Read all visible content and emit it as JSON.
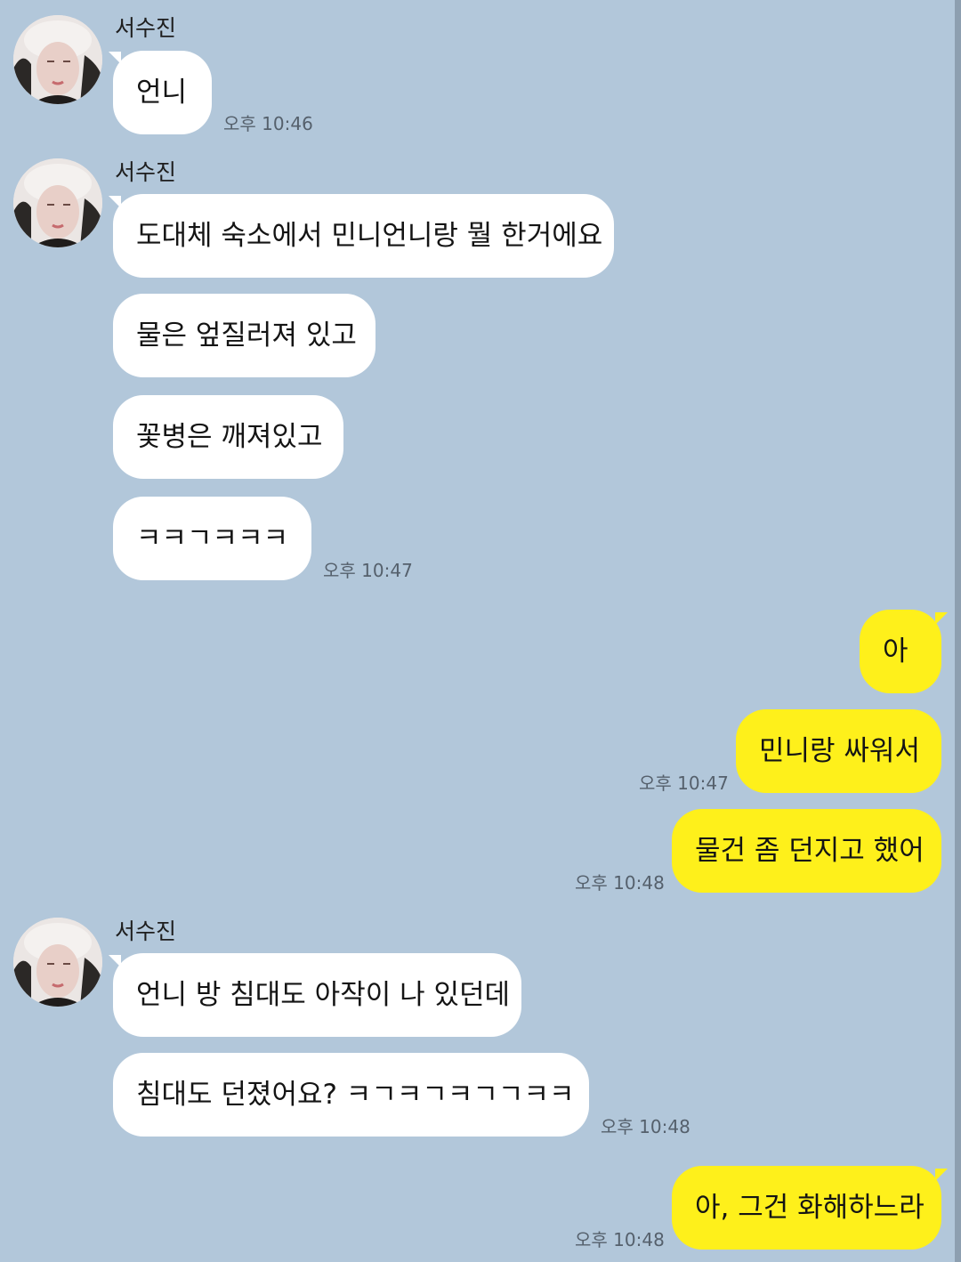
{
  "sender_name": "서수진",
  "messages": [
    {
      "text": "언니",
      "time": "오후 10:46"
    },
    {
      "text": "도대체 숙소에서 민니언니랑 뭘 한거에요"
    },
    {
      "text": "물은 엎질러져 있고"
    },
    {
      "text": "꽃병은 깨져있고"
    },
    {
      "text": "ㅋㅋㄱㅋㅋㅋ",
      "time": "오후 10:47"
    },
    {
      "text": "아"
    },
    {
      "text": "민니랑 싸워서",
      "time": "오후 10:47"
    },
    {
      "text": "물건 좀 던지고 했어",
      "time": "오후 10:48"
    },
    {
      "text": "언니 방 침대도 아작이 나 있던데"
    },
    {
      "text": "침대도 던졌어요? ㅋㄱㅋㄱㅋㄱㄱㅋㅋ",
      "time": "오후 10:48"
    },
    {
      "text": "아, 그건 화해하느라",
      "time": "오후 10:48"
    }
  ],
  "colors": {
    "background": "#b2c7da",
    "incoming": "#ffffff",
    "outgoing": "#fef01b"
  },
  "icons": {
    "avatar": "profile-photo"
  }
}
